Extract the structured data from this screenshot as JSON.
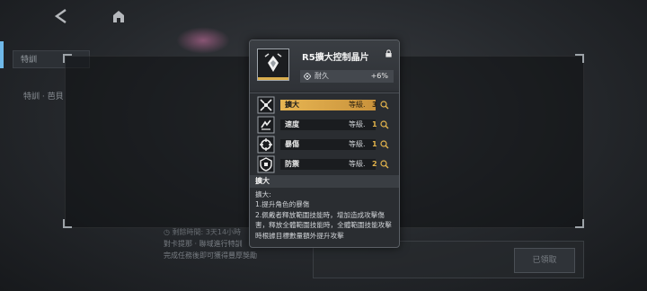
{
  "background": {
    "tab_label": "特訓",
    "sub_label": "特訓 · 芭貝",
    "time_label": "剩餘時間:",
    "time_value": "3天14小時",
    "hint_line1": "對卡提那 · 聯域進行特訓",
    "hint_line2": "完成任務後即可獲得豐厚獎勵",
    "claim_button": "已領取"
  },
  "item": {
    "name": "R5擴大控制晶片",
    "durability_label": "耐久",
    "durability_value": "+6%"
  },
  "stats": [
    {
      "name": "擴大",
      "level_label": "等級.",
      "level": "3",
      "active": true,
      "icon": "expand-icon"
    },
    {
      "name": "速度",
      "level_label": "等級.",
      "level": "1",
      "active": false,
      "icon": "speed-icon"
    },
    {
      "name": "暴傷",
      "level_label": "等級.",
      "level": "1",
      "active": false,
      "icon": "crit-damage-icon"
    },
    {
      "name": "防禦",
      "level_label": "等級.",
      "level": "2",
      "active": false,
      "icon": "defense-icon"
    }
  ],
  "description": {
    "header": "擴大",
    "title": "擴大:",
    "line1": "1.提升角色的暴傷",
    "line2": "2.佩戴者釋放範圍技能時，增加造成攻擊傷害，釋放全體範圍技能時，全體範圍技能攻擊時根據目標數量額外提升攻擊"
  },
  "colors": {
    "accent_gold": "#e2b34c",
    "panel": "#2a2d31"
  }
}
